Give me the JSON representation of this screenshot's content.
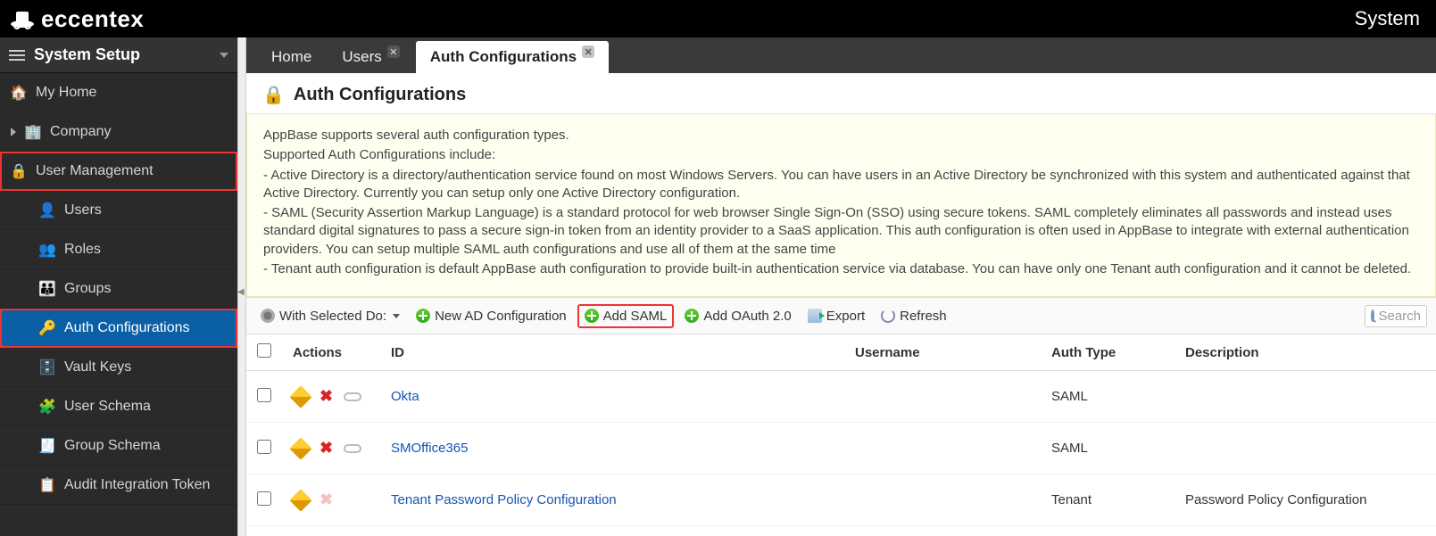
{
  "brand": "eccentex",
  "top_link": "System",
  "sidebar": {
    "title": "System Setup",
    "items": [
      {
        "label": "My Home",
        "icon": "home-icon"
      },
      {
        "label": "Company",
        "icon": "company-icon",
        "expandable": true
      },
      {
        "label": "User Management",
        "icon": "lock-icon",
        "highlight": true
      },
      {
        "label": "Users",
        "icon": "user-icon",
        "child": true
      },
      {
        "label": "Roles",
        "icon": "role-icon",
        "child": true
      },
      {
        "label": "Groups",
        "icon": "group-icon",
        "child": true
      },
      {
        "label": "Auth Configurations",
        "icon": "key-icon",
        "child": true,
        "active": true,
        "highlight": true
      },
      {
        "label": "Vault Keys",
        "icon": "vault-icon",
        "child": true
      },
      {
        "label": "User Schema",
        "icon": "userschema-icon",
        "child": true
      },
      {
        "label": "Group Schema",
        "icon": "groupschema-icon",
        "child": true
      },
      {
        "label": "Audit Integration Token",
        "icon": "audit-icon",
        "child": true
      }
    ]
  },
  "tabs": [
    {
      "label": "Home",
      "closable": false
    },
    {
      "label": "Users",
      "closable": true
    },
    {
      "label": "Auth Configurations",
      "closable": true,
      "active": true
    }
  ],
  "page_title": "Auth Configurations",
  "info": {
    "l1": "AppBase supports several auth configuration types.",
    "l2": "Supported Auth Configurations include:",
    "l3": "- Active Directory is a directory/authentication service found on most Windows Servers. You can have users in an Active Directory be synchronized with this system and authenticated against that Active Directory. Currently you can setup only one Active Directory configuration.",
    "l4": "- SAML (Security Assertion Markup Language) is a standard protocol for web browser Single Sign-On (SSO) using secure tokens. SAML completely eliminates all passwords and instead uses standard digital signatures to pass a secure sign-in token from an identity provider to a SaaS application. This auth configuration is often used in AppBase to integrate with external authentication providers. You can setup multiple SAML auth configurations and use all of them at the same time",
    "l5": "- Tenant auth configuration is default AppBase auth configuration to provide built-in authentication service via database. You can have only one Tenant auth configuration and it cannot be deleted."
  },
  "toolbar": {
    "with_selected": "With Selected Do:",
    "new_ad": "New AD Configuration",
    "add_saml": "Add SAML",
    "add_oauth": "Add OAuth 2.0",
    "export": "Export",
    "refresh": "Refresh",
    "search_placeholder": "Search"
  },
  "table": {
    "headers": {
      "actions": "Actions",
      "id": "ID",
      "username": "Username",
      "auth_type": "Auth Type",
      "description": "Description"
    },
    "rows": [
      {
        "id": "Okta",
        "username": "",
        "auth_type": "SAML",
        "description": "",
        "deletable": true,
        "linkable": true
      },
      {
        "id": "SMOffice365",
        "username": "",
        "auth_type": "SAML",
        "description": "",
        "deletable": true,
        "linkable": true
      },
      {
        "id": "Tenant Password Policy Configuration",
        "username": "",
        "auth_type": "Tenant",
        "description": "Password Policy Configuration",
        "deletable": false,
        "linkable": false
      }
    ]
  }
}
